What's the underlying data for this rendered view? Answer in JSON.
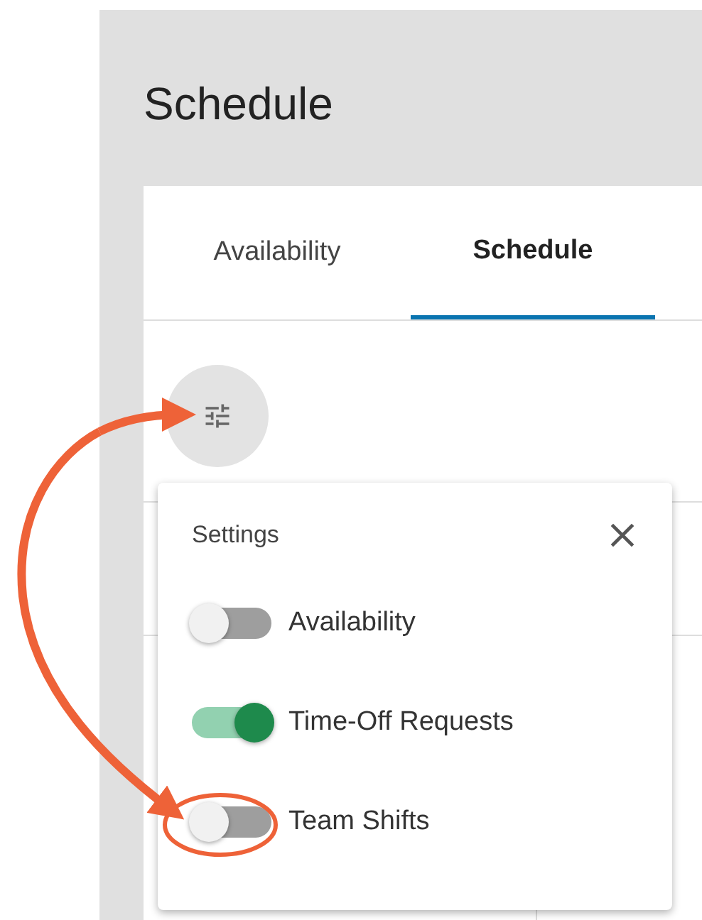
{
  "page": {
    "title": "Schedule"
  },
  "tabs": [
    {
      "label": "Availability",
      "selected": false
    },
    {
      "label": "Schedule",
      "selected": true
    }
  ],
  "settings_popup": {
    "title": "Settings",
    "toggles": [
      {
        "label": "Availability",
        "on": false
      },
      {
        "label": "Time-Off Requests",
        "on": true
      },
      {
        "label": "Team Shifts",
        "on": false
      }
    ]
  }
}
